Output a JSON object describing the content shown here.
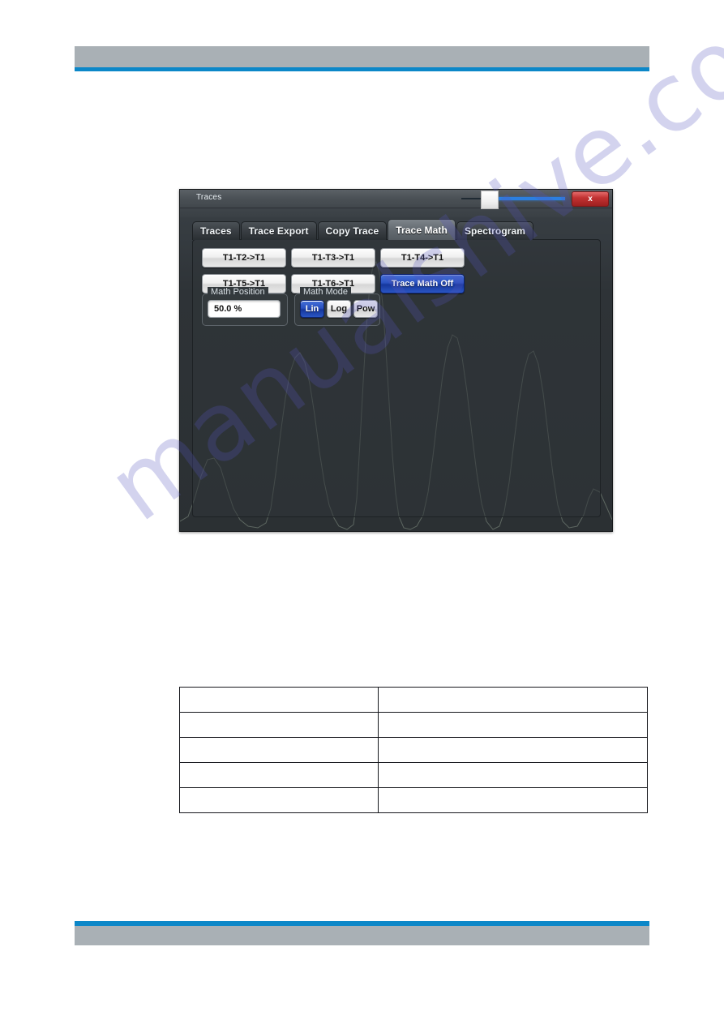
{
  "page": {
    "background_color": "#ffffff",
    "header": {
      "bar_color": "#a9b0b5",
      "rule_color": "#0c87c8",
      "text": ""
    },
    "footer": {
      "bar_color": "#a9b0b5",
      "rule_color": "#0c87c8",
      "text": ""
    },
    "watermark": {
      "text": "manualshive.com",
      "color": "#5656be",
      "rotation_deg": -36
    }
  },
  "dialog": {
    "title": "Traces",
    "close_label": "x",
    "background_color": "#2f3438",
    "blur_menu_text": "                                      ",
    "blur_menu_text2": "               ",
    "tabs": [
      {
        "label": "Traces",
        "active": false
      },
      {
        "label": "Trace Export",
        "active": false
      },
      {
        "label": "Copy Trace",
        "active": false
      },
      {
        "label": "Trace Math",
        "active": true
      },
      {
        "label": "Spectrogram",
        "active": false
      }
    ],
    "function_buttons": [
      {
        "label": "T1-T2->T1",
        "selected": false
      },
      {
        "label": "T1-T3->T1",
        "selected": false
      },
      {
        "label": "T1-T4->T1",
        "selected": false
      },
      {
        "label": "T1-T5->T1",
        "selected": false
      },
      {
        "label": "T1-T6->T1",
        "selected": false
      },
      {
        "label": "Trace Math Off",
        "selected": true
      }
    ],
    "math_position": {
      "group_label": "Math Position",
      "value": "50.0 %"
    },
    "math_mode": {
      "group_label": "Math Mode",
      "options": [
        {
          "label": "Lin",
          "selected": true
        },
        {
          "label": "Log",
          "selected": false
        },
        {
          "label": "Pow",
          "selected": false
        }
      ]
    },
    "accent_selected_color": "#2a51c0"
  },
  "param_table": {
    "rows": [
      {
        "name": "",
        "value": ""
      },
      {
        "name": "",
        "value": ""
      },
      {
        "name": "",
        "value": ""
      },
      {
        "name": "",
        "value": ""
      },
      {
        "name": "",
        "value": ""
      }
    ]
  }
}
